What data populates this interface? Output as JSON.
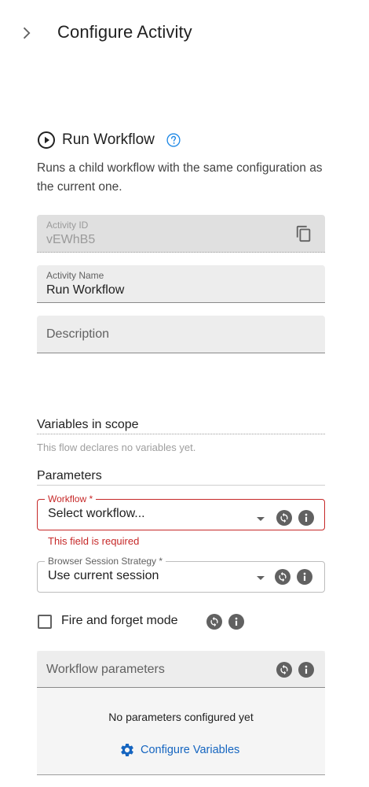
{
  "header": {
    "title": "Configure Activity"
  },
  "activity": {
    "title": "Run Workflow",
    "description": "Runs a child workflow with the same configuration as the current one."
  },
  "fields": {
    "activity_id": {
      "label": "Activity ID",
      "value": "vEWhB5"
    },
    "activity_name": {
      "label": "Activity Name",
      "value": "Run Workflow"
    },
    "description": {
      "placeholder": "Description"
    }
  },
  "variables": {
    "title": "Variables in scope",
    "empty_text": "This flow declares no variables yet."
  },
  "parameters": {
    "title": "Parameters",
    "workflow": {
      "label": "Workflow *",
      "value": "Select workflow...",
      "error": "This field is required"
    },
    "browser_session": {
      "label": "Browser Session Strategy *",
      "value": "Use current session"
    },
    "fire_and_forget": {
      "label": "Fire and forget mode",
      "checked": false
    }
  },
  "workflow_parameters": {
    "title": "Workflow parameters",
    "empty_text": "No parameters configured yet",
    "configure_label": "Configure Variables"
  },
  "colors": {
    "accent": "#1565c0",
    "error": "#c62828",
    "icon_gray": "#616161"
  }
}
